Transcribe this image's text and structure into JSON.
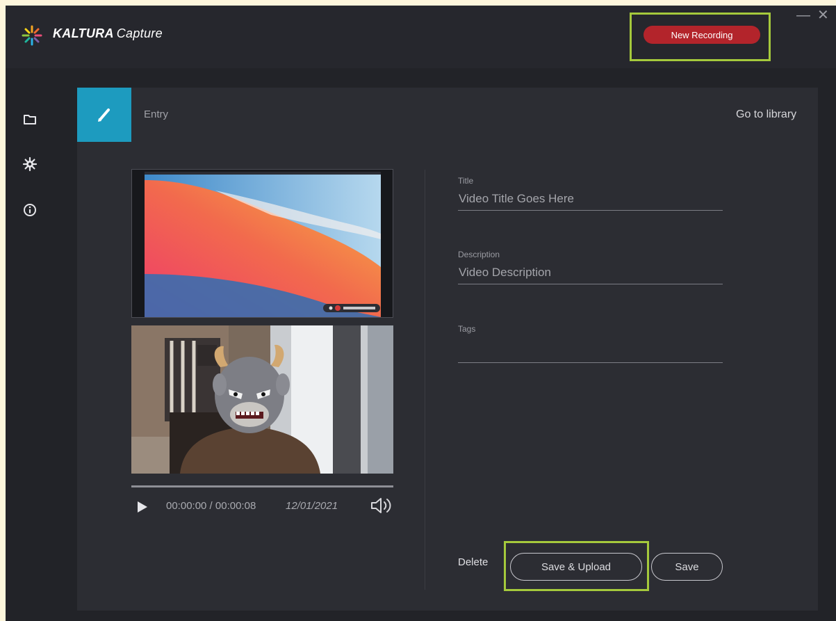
{
  "app": {
    "brand_bold": "KALTURA",
    "brand_light": "Capture",
    "new_recording": "New Recording",
    "window_min": "—",
    "window_close": "✕"
  },
  "sidebar": {
    "items": [
      {
        "icon": "folder-icon"
      },
      {
        "icon": "gear-icon"
      },
      {
        "icon": "info-icon"
      }
    ]
  },
  "header": {
    "tab_label": "Entry",
    "go_to_library": "Go to library"
  },
  "player": {
    "time": "00:00:00 / 00:00:08",
    "date": "12/01/2021"
  },
  "form": {
    "title_label": "Title",
    "title_value": "Video Title Goes Here",
    "description_label": "Description",
    "description_value": "Video Description",
    "tags_label": "Tags",
    "tags_value": ""
  },
  "actions": {
    "delete": "Delete",
    "save_upload": "Save & Upload",
    "save": "Save"
  },
  "colors": {
    "accent": "#1d9bbf",
    "record": "#b3242b",
    "highlight": "#a5c93c",
    "background": "#222328",
    "panel": "#2c2d33"
  }
}
